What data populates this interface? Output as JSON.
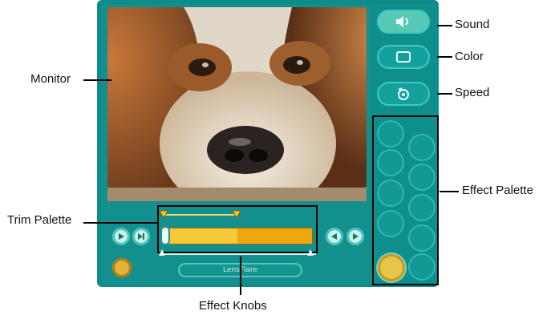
{
  "labels": {
    "sound": "Sound",
    "color": "Color",
    "speed": "Speed",
    "monitor": "Monitor",
    "effect_palette": "Effect Palette",
    "trim_palette": "Trim Palette",
    "effect_knobs": "Effect Knobs"
  },
  "effect_name": "LensFlare",
  "icons": {
    "sound": "speaker-icon",
    "color": "color-square-icon",
    "speed": "speed-swirl-icon",
    "play": "play-icon",
    "step": "step-icon",
    "prev": "rewind-icon",
    "next": "forward-icon",
    "record": "record-icon"
  },
  "colors": {
    "device": "#0e8c8a",
    "trim_bar": "#f0a70e",
    "trim_selected": "#f7c93a"
  }
}
